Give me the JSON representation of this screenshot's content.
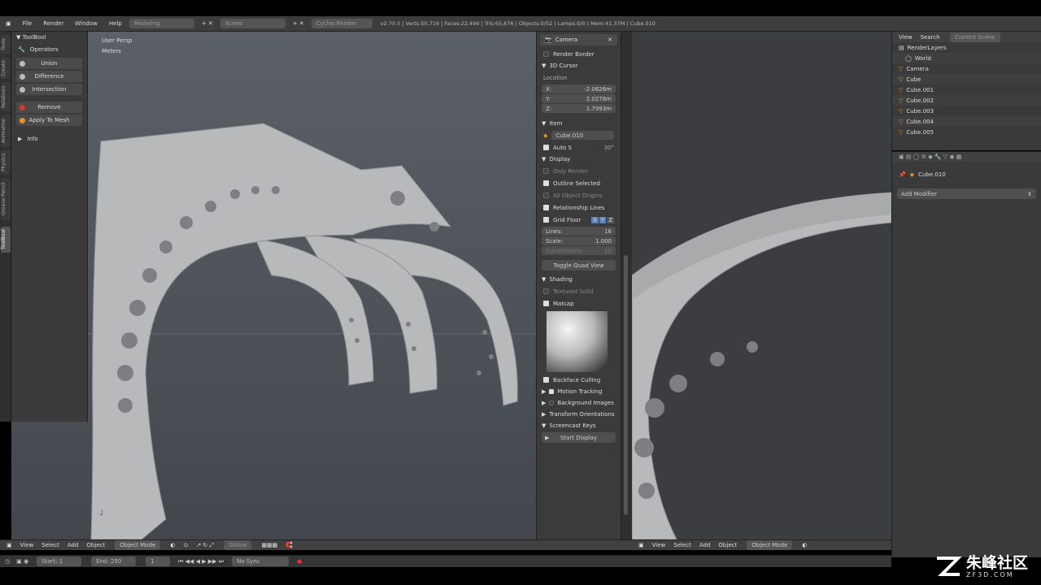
{
  "topbar": {
    "menus": [
      "File",
      "Render",
      "Window",
      "Help"
    ],
    "layout": "Modeling",
    "scene": "Scene",
    "engine": "Cycles Render",
    "stats": "v2.70.5 | Verts:50,716 | Faces:22,494 | Tris:65,676 | Objects:0/52 | Lamps:0/0 | Mem:41.37M | Cube.010"
  },
  "left_tabs": [
    "Tools",
    "Create",
    "Relations",
    "Animation",
    "Physics",
    "Grease Pencil",
    "ToolBool"
  ],
  "toolshelf": {
    "title": "ToolBool",
    "operators": "Operators",
    "buttons": [
      "Union",
      "Difference",
      "Intersection"
    ],
    "remove": "Remove",
    "apply": "Apply To Mesh",
    "info": "Info"
  },
  "viewport1": {
    "view_label": "User Persp",
    "units": "Meters"
  },
  "npanel": {
    "camera": "Camera",
    "render_border": "Render Border",
    "cursor": {
      "title": "3D Cursor",
      "location": "Location",
      "x_label": "X:",
      "x": "-2.0626m",
      "y_label": "Y:",
      "y": "2.0278m",
      "z_label": "Z:",
      "z": "1.7993m"
    },
    "item": {
      "title": "Item",
      "name": "Cube.010",
      "auto_smooth": "Auto S",
      "angle": "30°"
    },
    "display": {
      "title": "Display",
      "only_render": "Only Render",
      "outline": "Outline Selected",
      "all_origins": "All Object Origins",
      "relationship": "Relationship Lines",
      "grid_floor": "Grid Floor",
      "axes": [
        "X",
        "Y",
        "Z"
      ],
      "lines_label": "Lines:",
      "lines": "16",
      "scale_label": "Scale:",
      "scale": "1.000",
      "subdivisions_label": "Subdivisions:",
      "subdivisions": "10",
      "toggle_quad": "Toggle Quad View"
    },
    "shading": {
      "title": "Shading",
      "textured_solid": "Textured Solid",
      "matcap": "Matcap",
      "backface": "Backface Culling"
    },
    "more": [
      "Motion Tracking",
      "Background Images",
      "Transform Orientations"
    ],
    "screencast": {
      "title": "Screencast Keys",
      "start": "Start Display"
    }
  },
  "outliner": {
    "tabs": [
      "View",
      "Search",
      "Current Scene"
    ],
    "items": [
      "RenderLayers",
      "World",
      "Camera",
      "Cube",
      "Cube.001",
      "Cube.002",
      "Cube.003",
      "Cube.004",
      "Cube.005"
    ]
  },
  "properties": {
    "object": "Cube.010",
    "add_modifier": "Add Modifier"
  },
  "header1": {
    "items": [
      "View",
      "Select",
      "Add",
      "Object"
    ],
    "mode": "Object Mode",
    "orientation": "Global"
  },
  "header2": {
    "items": [
      "View",
      "Select",
      "Add",
      "Object"
    ],
    "mode": "Object Mode"
  },
  "timeline": {
    "start_label": "Start:",
    "start": "1",
    "end_label": "End:",
    "end": "250",
    "current": "1",
    "sync": "No Sync"
  },
  "watermark": {
    "cn": "朱峰社区",
    "site": "ZF3D.COM"
  }
}
